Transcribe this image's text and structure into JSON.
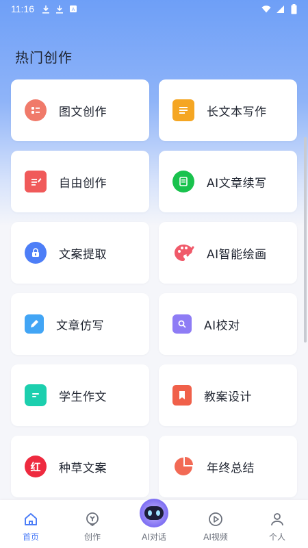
{
  "status_bar": {
    "time": "11:16",
    "left_icons": [
      "download-icon",
      "download-icon",
      "app-notification-icon"
    ],
    "right_icons": [
      "wifi-icon",
      "cellular-icon",
      "battery-icon"
    ]
  },
  "section_title": "热门创作",
  "cards": [
    {
      "label": "图文创作",
      "icon": "image-text-icon",
      "color": "#f07a6a"
    },
    {
      "label": "长文本写作",
      "icon": "document-icon",
      "color": "#f5a623"
    },
    {
      "label": "自由创作",
      "icon": "edit-note-icon",
      "color": "#f05a5a"
    },
    {
      "label": "AI文章续写",
      "icon": "article-continue-icon",
      "color": "#19c24d"
    },
    {
      "label": "文案提取",
      "icon": "lock-extract-icon",
      "color": "#4d7ef7"
    },
    {
      "label": "AI智能绘画",
      "icon": "palette-icon",
      "color": "#f05a6a"
    },
    {
      "label": "文章仿写",
      "icon": "pencil-icon",
      "color": "#42a5f5"
    },
    {
      "label": "AI校对",
      "icon": "magnify-document-icon",
      "color": "#8e7cf5"
    },
    {
      "label": "学生作文",
      "icon": "note-icon",
      "color": "#1ccfae"
    },
    {
      "label": "教案设计",
      "icon": "bookmark-icon",
      "color": "#f0604a"
    },
    {
      "label": "种草文案",
      "icon": "red-badge-icon",
      "color": "#ee2a3f",
      "badge_text": "红"
    },
    {
      "label": "年终总结",
      "icon": "pie-chart-icon",
      "color": "#f26a55"
    }
  ],
  "bottom_nav": [
    {
      "label": "首页",
      "icon": "home-icon",
      "active": true
    },
    {
      "label": "创作",
      "icon": "create-icon",
      "active": false
    },
    {
      "label": "AI对话",
      "icon": "robot-icon",
      "active": false
    },
    {
      "label": "AI视频",
      "icon": "video-play-icon",
      "active": false
    },
    {
      "label": "个人",
      "icon": "person-icon",
      "active": false
    }
  ],
  "colors": {
    "accent": "#4d7ef7",
    "header_gradient_top": "#6e9ff7",
    "background": "#f5f6fa"
  }
}
